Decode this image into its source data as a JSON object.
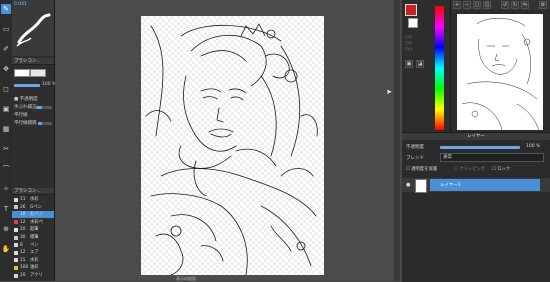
{
  "top_labels": {
    "left": "表示の仮面",
    "right": "100%"
  },
  "tools": [
    "✎",
    "▭",
    "✐",
    "✥",
    "◻",
    "▣",
    "▦",
    "✂",
    "⌒",
    "✧",
    "T",
    "⊕",
    "✋"
  ],
  "brush_panel": {
    "title": "ブラシコン...",
    "size_label": "Size",
    "size_value": "0.041",
    "opacity_label": "不透明度",
    "opacity_value": "100 %",
    "opt1": "■ 不透明度",
    "opt2": "手ぶれ補正",
    "opt3": "平行線",
    "opt4": "平行線間隔"
  },
  "brush_list": {
    "title": "ブラシコン...",
    "items": [
      {
        "num": "11",
        "name": "水彩",
        "color": "#d8d8d8"
      },
      {
        "num": "26",
        "name": "Gペン",
        "color": "#c8c8c8"
      },
      {
        "num": "18",
        "name": "丸ペン",
        "color": "#4a90d9"
      },
      {
        "num": "12",
        "name": "水彩ぺ",
        "color": "#d64545"
      },
      {
        "num": "20",
        "name": "鉛筆",
        "color": "#e0e0e0"
      },
      {
        "num": "30",
        "name": "擦筆",
        "color": "#c8c8c8"
      },
      {
        "num": "8",
        "name": "ペン",
        "color": "#d8d8d8"
      },
      {
        "num": "12",
        "name": "エア",
        "color": "#d8d8d8"
      },
      {
        "num": "15",
        "name": "水彩",
        "color": "#d8d8d8"
      },
      {
        "num": "100",
        "name": "油彩",
        "color": "#e0c040"
      },
      {
        "num": "20",
        "name": "アクリ",
        "color": "#d8d8d8"
      }
    ]
  },
  "layer_panel": {
    "title": "レイヤー",
    "opacity_label": "不透明度",
    "opacity_value": "100 %",
    "blend_label": "ブレンド",
    "blend_value": "通常",
    "check1": "透明度を保護",
    "check2": "クリッピング",
    "check3": "ロック",
    "layer_name": "レイヤー1"
  },
  "colors": {
    "accent": "#4a90d9",
    "fg": "#cc1f1f"
  }
}
